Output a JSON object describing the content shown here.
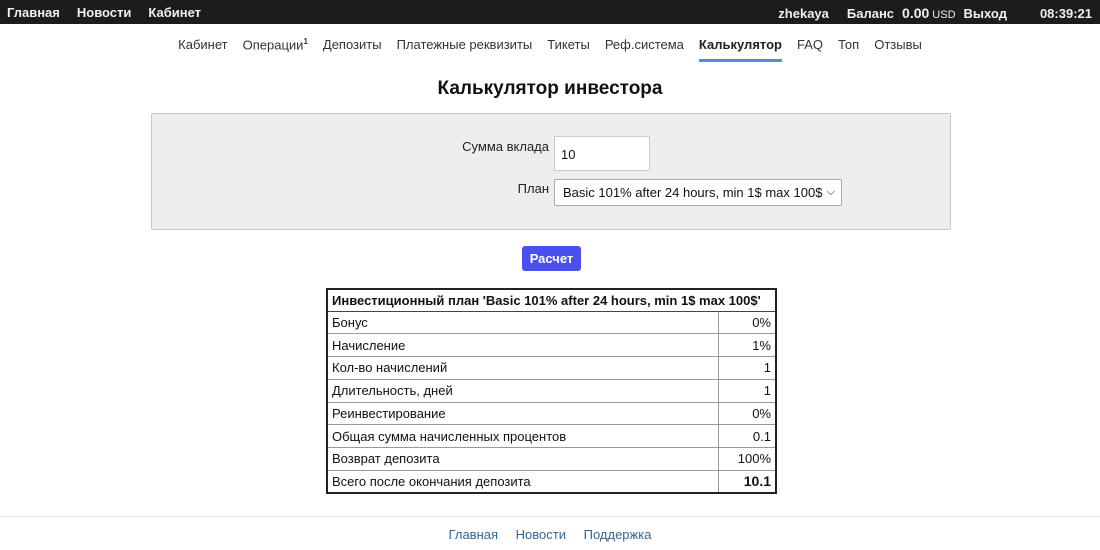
{
  "topbar": {
    "links": [
      "Главная",
      "Новости",
      "Кабинет"
    ],
    "username": "zhekaya",
    "balance_label": "Баланс",
    "balance_value": "0.00",
    "balance_currency": "USD",
    "logout": "Выход",
    "time": "08:39:21"
  },
  "nav": {
    "items": [
      {
        "label": "Кабинет"
      },
      {
        "label": "Операции",
        "badge": "1"
      },
      {
        "label": "Депозиты"
      },
      {
        "label": "Платежные реквизиты"
      },
      {
        "label": "Тикеты"
      },
      {
        "label": "Реф.система"
      },
      {
        "label": "Калькулятор",
        "active": true
      },
      {
        "label": "FAQ"
      },
      {
        "label": "Топ"
      },
      {
        "label": "Отзывы"
      }
    ]
  },
  "page_title": "Калькулятор инвестора",
  "form": {
    "sum_label": "Сумма вклада",
    "sum_value": "10",
    "plan_label": "План",
    "plan_selected": "Basic 101% after 24 hours, min 1$ max 100$",
    "submit": "Расчет"
  },
  "results": {
    "header": "Инвестиционный план 'Basic 101% after 24 hours, min 1$ max 100$'",
    "rows": [
      {
        "label": "Бонус",
        "value": "0%"
      },
      {
        "label": "Начисление",
        "value": "1%"
      },
      {
        "label": "Кол-во начислений",
        "value": "1"
      },
      {
        "label": "Длительность, дней",
        "value": "1"
      },
      {
        "label": "Реинвестирование",
        "value": "0%"
      },
      {
        "label": "Общая сумма начисленных процентов",
        "value": "0.1"
      },
      {
        "label": "Возврат депозита",
        "value": "100%"
      },
      {
        "label": "Всего после окончания депозита",
        "value": "10.1"
      }
    ]
  },
  "footer": {
    "links": [
      "Главная",
      "Новости",
      "Поддержка"
    ]
  },
  "colors": {
    "accent": "#4a90d9",
    "button": "#4a4ff0",
    "topbar": "#1c1c1c",
    "footer_link": "#336699"
  }
}
